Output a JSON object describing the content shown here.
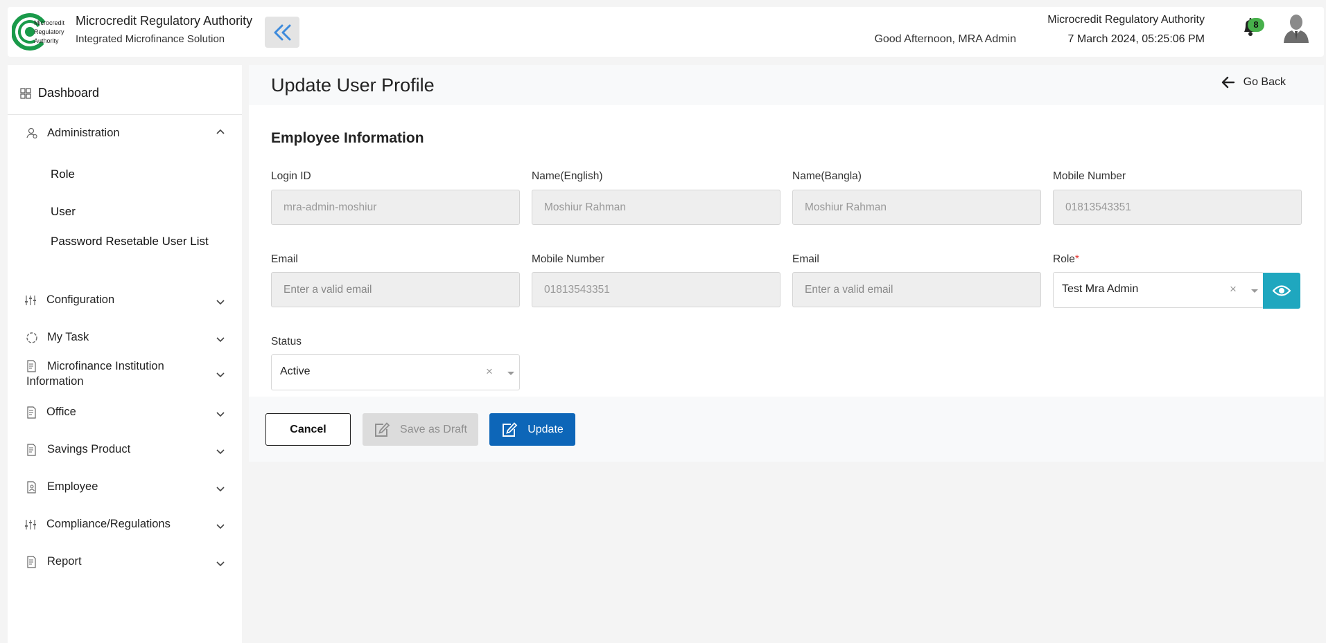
{
  "header": {
    "logo_text": [
      "Microcredit",
      "Regulatory",
      "Authority"
    ],
    "title": "Microcredit Regulatory Authority",
    "subtitle": "Integrated Microfinance Solution",
    "greeting": "Good Afternoon, MRA Admin",
    "org_name": "Microcredit Regulatory Authority",
    "datetime": "7 March 2024, 05:25:06 PM",
    "notification_count": "8"
  },
  "sidebar": {
    "dashboard": "Dashboard",
    "administration": {
      "label": "Administration",
      "children": [
        "Role",
        "User",
        "Password Resetable User List"
      ]
    },
    "items": [
      "Configuration",
      "My Task",
      "Microfinance Institution Information",
      "Office",
      "Savings Product",
      "Employee",
      "Compliance/Regulations",
      "Report"
    ]
  },
  "page": {
    "title": "Update User Profile",
    "go_back": "Go Back",
    "section_title": "Employee Information"
  },
  "form": {
    "login_id": {
      "label": "Login ID",
      "value": "mra-admin-moshiur"
    },
    "name_english": {
      "label": "Name(English)",
      "value": "Moshiur Rahman"
    },
    "name_bangla": {
      "label": "Name(Bangla)",
      "value": "Moshiur Rahman"
    },
    "mobile_1": {
      "label": "Mobile Number",
      "value": "01813543351"
    },
    "email_1": {
      "label": "Email",
      "placeholder": "Enter a valid email"
    },
    "mobile_2": {
      "label": "Mobile Number",
      "value": "01813543351"
    },
    "email_2": {
      "label": "Email",
      "placeholder": "Enter a valid email"
    },
    "role": {
      "label": "Role",
      "required_mark": "*",
      "value": "Test Mra Admin"
    },
    "status": {
      "label": "Status",
      "value": "Active"
    }
  },
  "actions": {
    "cancel": "Cancel",
    "save_draft": "Save as Draft",
    "update": "Update"
  },
  "colors": {
    "primary": "#0d66b8",
    "eye_button": "#1fa7bf",
    "badge": "#47b04b",
    "logo_green": "#1a9a4a"
  }
}
